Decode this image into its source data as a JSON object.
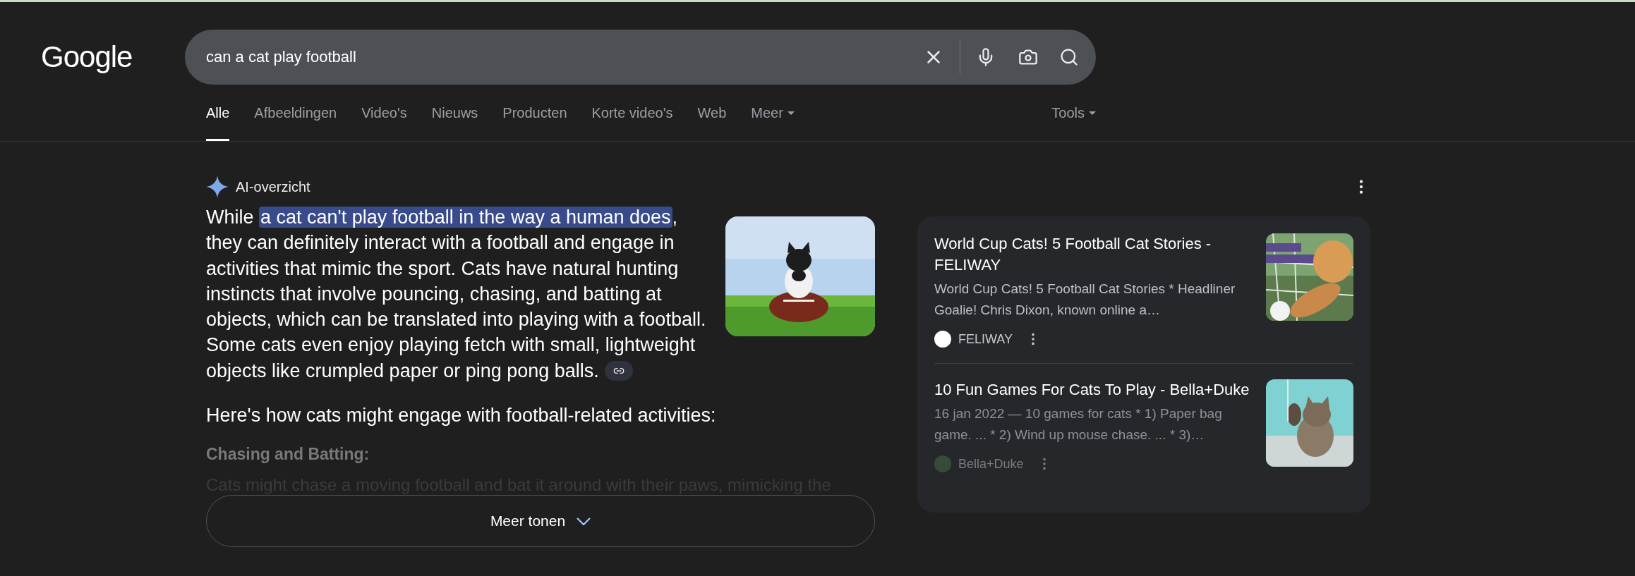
{
  "logo": "Google",
  "search": {
    "value": "can a cat play football"
  },
  "tabs": [
    {
      "label": "Alle",
      "selected": true,
      "kind": "tab"
    },
    {
      "label": "Afbeeldingen",
      "selected": false,
      "kind": "tab"
    },
    {
      "label": "Video's",
      "selected": false,
      "kind": "tab"
    },
    {
      "label": "Nieuws",
      "selected": false,
      "kind": "tab"
    },
    {
      "label": "Producten",
      "selected": false,
      "kind": "tab"
    },
    {
      "label": "Korte video's",
      "selected": false,
      "kind": "tab"
    },
    {
      "label": "Web",
      "selected": false,
      "kind": "tab"
    },
    {
      "label": "Meer",
      "selected": false,
      "kind": "menu"
    }
  ],
  "tools": "Tools",
  "ai_overview": {
    "title": "AI-overzicht",
    "paragraph": {
      "before": "While ",
      "highlight": "a cat can't play football in the way a human does",
      "after": ", they can definitely interact with a football and engage in activities that mimic the sport. Cats have natural hunting instincts that involve pouncing, chasing, and batting at objects, which can be translated into playing with a football. Some cats even enjoy playing fetch with small, lightweight objects like crumpled paper or ping pong balls."
    },
    "intro": "Here's how cats might engage with football-related activities:",
    "heading": "Chasing and Batting:",
    "faded_text": "Cats might chase a moving football and bat it around with their paws, mimicking the",
    "more_button": "Meer tonen"
  },
  "sources": [
    {
      "title": "World Cup Cats! 5 Football Cat Stories - FELIWAY",
      "snippet": "World Cup Cats! 5 Football Cat Stories * Headliner Goalie! Chris Dixon, known online a…",
      "site": "FELIWAY",
      "faded": false
    },
    {
      "title": "10 Fun Games For Cats To Play - Bella+Duke",
      "snippet": "16 jan 2022 — 10 games for cats * 1) Paper bag game. ... * 2) Wind up mouse chase. ... * 3)…",
      "site": "Bella+Duke",
      "faded": true
    }
  ]
}
